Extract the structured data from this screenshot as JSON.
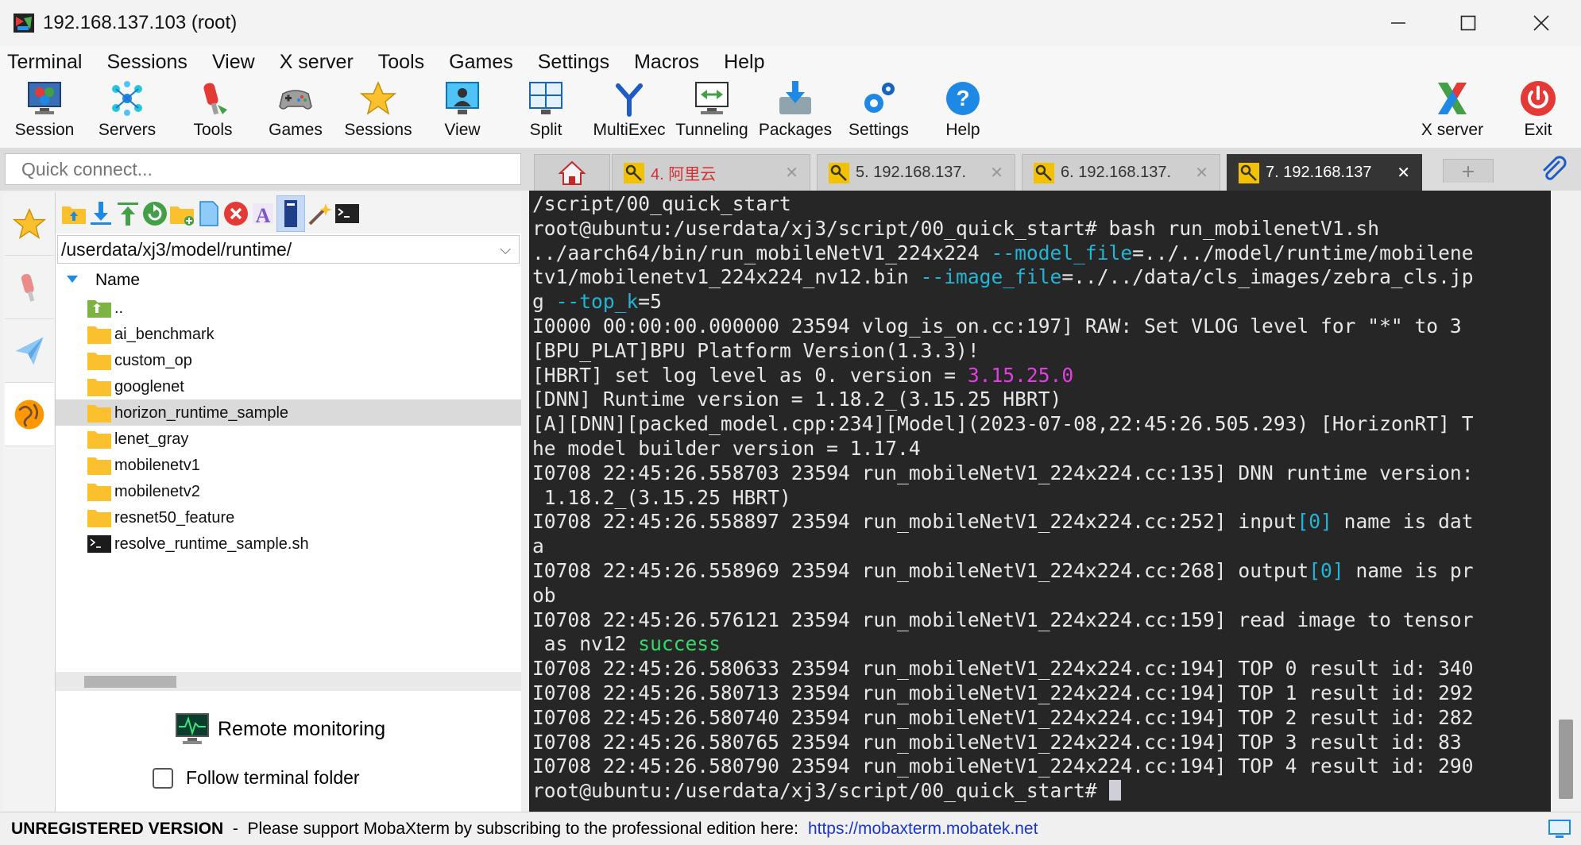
{
  "window": {
    "title": "192.168.137.103 (root)"
  },
  "menu": [
    "Terminal",
    "Sessions",
    "View",
    "X server",
    "Tools",
    "Games",
    "Settings",
    "Macros",
    "Help"
  ],
  "toolbar": [
    {
      "label": "Session",
      "icon": "session-icon"
    },
    {
      "label": "Servers",
      "icon": "servers-icon"
    },
    {
      "label": "Tools",
      "icon": "tools-icon"
    },
    {
      "label": "Games",
      "icon": "games-icon"
    },
    {
      "label": "Sessions",
      "icon": "sessions-star-icon"
    },
    {
      "label": "View",
      "icon": "view-icon"
    },
    {
      "label": "Split",
      "icon": "split-icon"
    },
    {
      "label": "MultiExec",
      "icon": "multiexec-icon"
    },
    {
      "label": "Tunneling",
      "icon": "tunneling-icon"
    },
    {
      "label": "Packages",
      "icon": "packages-icon"
    },
    {
      "label": "Settings",
      "icon": "settings-icon"
    },
    {
      "label": "Help",
      "icon": "help-icon"
    },
    {
      "label": "X server",
      "icon": "x-server-icon"
    },
    {
      "label": "Exit",
      "icon": "exit-icon"
    }
  ],
  "quick_connect": {
    "placeholder": "Quick connect..."
  },
  "tabs": [
    {
      "label": "4. 阿里云",
      "active": false
    },
    {
      "label": "5. 192.168.137.",
      "active": false
    },
    {
      "label": "6. 192.168.137.",
      "active": false
    },
    {
      "label": "7. 192.168.137",
      "active": true
    }
  ],
  "file_browser": {
    "path": "/userdata/xj3/model/runtime/",
    "column_name": "Name",
    "items": [
      {
        "name": "..",
        "type": "parent"
      },
      {
        "name": "ai_benchmark",
        "type": "folder"
      },
      {
        "name": "custom_op",
        "type": "folder"
      },
      {
        "name": "googlenet",
        "type": "folder"
      },
      {
        "name": "horizon_runtime_sample",
        "type": "folder",
        "selected": true
      },
      {
        "name": "lenet_gray",
        "type": "folder"
      },
      {
        "name": "mobilenetv1",
        "type": "folder"
      },
      {
        "name": "mobilenetv2",
        "type": "folder"
      },
      {
        "name": "resnet50_feature",
        "type": "folder"
      },
      {
        "name": "resolve_runtime_sample.sh",
        "type": "script"
      }
    ],
    "remote_monitoring": "Remote monitoring",
    "follow_terminal": "Follow terminal folder"
  },
  "terminal": {
    "lines": [
      [
        {
          "t": "/script/00_quick_start"
        }
      ],
      [
        {
          "t": "root@ubuntu:/userdata/xj3/script/00_quick_start# bash run_mobilenetV1.sh"
        }
      ],
      [
        {
          "t": "../aarch64/bin/run_mobileNetV1_224x224 "
        },
        {
          "t": "--model_file",
          "c": "cyan"
        },
        {
          "t": "=../../model/runtime/mobilene"
        }
      ],
      [
        {
          "t": "tv1/mobilenetv1_224x224_nv12.bin "
        },
        {
          "t": "--image_file",
          "c": "cyan"
        },
        {
          "t": "=../../data/cls_images/zebra_cls.jp"
        }
      ],
      [
        {
          "t": "g "
        },
        {
          "t": "--top_k",
          "c": "cyan"
        },
        {
          "t": "=5"
        }
      ],
      [
        {
          "t": "I0000 00:00:00.000000 23594 vlog_is_on.cc:197] RAW: Set VLOG level for \"*\" to 3"
        }
      ],
      [
        {
          "t": "[BPU_PLAT]BPU Platform Version(1.3.3)!"
        }
      ],
      [
        {
          "t": "[HBRT] set log level as 0. version = "
        },
        {
          "t": "3.15.25.0",
          "c": "mag"
        }
      ],
      [
        {
          "t": "[DNN] Runtime version = 1.18.2_(3.15.25 HBRT)"
        }
      ],
      [
        {
          "t": "[A][DNN][packed_model.cpp:234][Model](2023-07-08,22:45:26.505.293) [HorizonRT] T"
        }
      ],
      [
        {
          "t": "he model builder version = 1.17.4"
        }
      ],
      [
        {
          "t": "I0708 22:45:26.558703 23594 run_mobileNetV1_224x224.cc:135] DNN runtime version:"
        }
      ],
      [
        {
          "t": " 1.18.2_(3.15.25 HBRT)"
        }
      ],
      [
        {
          "t": "I0708 22:45:26.558897 23594 run_mobileNetV1_224x224.cc:252] input"
        },
        {
          "t": "[0]",
          "c": "cyan"
        },
        {
          "t": " name is dat"
        }
      ],
      [
        {
          "t": "a"
        }
      ],
      [
        {
          "t": "I0708 22:45:26.558969 23594 run_mobileNetV1_224x224.cc:268] output"
        },
        {
          "t": "[0]",
          "c": "cyan"
        },
        {
          "t": " name is pr"
        }
      ],
      [
        {
          "t": "ob"
        }
      ],
      [
        {
          "t": "I0708 22:45:26.576121 23594 run_mobileNetV1_224x224.cc:159] read image to tensor"
        }
      ],
      [
        {
          "t": " as nv12 "
        },
        {
          "t": "success",
          "c": "grn"
        }
      ],
      [
        {
          "t": "I0708 22:45:26.580633 23594 run_mobileNetV1_224x224.cc:194] TOP 0 result id: 340"
        }
      ],
      [
        {
          "t": "I0708 22:45:26.580713 23594 run_mobileNetV1_224x224.cc:194] TOP 1 result id: 292"
        }
      ],
      [
        {
          "t": "I0708 22:45:26.580740 23594 run_mobileNetV1_224x224.cc:194] TOP 2 result id: 282"
        }
      ],
      [
        {
          "t": "I0708 22:45:26.580765 23594 run_mobileNetV1_224x224.cc:194] TOP 3 result id: 83"
        }
      ],
      [
        {
          "t": "I0708 22:45:26.580790 23594 run_mobileNetV1_224x224.cc:194] TOP 4 result id: 290"
        }
      ],
      [
        {
          "t": "root@ubuntu:/userdata/xj3/script/00_quick_start# "
        }
      ]
    ]
  },
  "status_bar": {
    "bold": "UNREGISTERED VERSION",
    "message": "  -  Please support MobaXterm by subscribing to the professional edition here:",
    "link": "https://mobaxterm.mobatek.net"
  },
  "colors": {
    "terminal_bg": "#262626",
    "active_tab": "#343434",
    "link": "#1a36c8",
    "cyan": "#23b5d6",
    "magenta": "#e23fe2",
    "green": "#36d96b"
  }
}
